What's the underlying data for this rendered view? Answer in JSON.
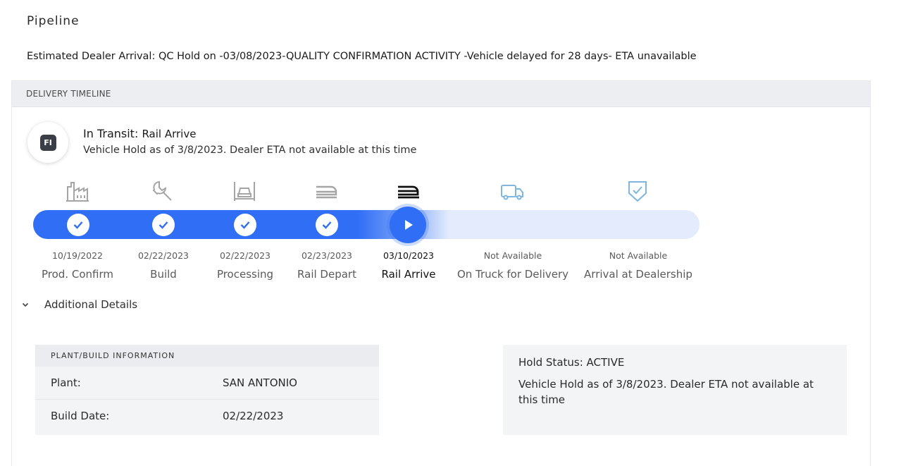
{
  "page": {
    "title": "Pipeline",
    "eta_text": "Estimated Dealer Arrival: QC Hold on -03/08/2023-QUALITY CONFIRMATION ACTIVITY -Vehicle delayed for 28 days- ETA unavailable"
  },
  "timeline": {
    "header": "DELIVERY TIMELINE",
    "avatar_initials": "FI",
    "status_label": "In Transit:",
    "status_stage": "Rail Arrive",
    "status_message": "Vehicle Hold as of 3/8/2023. Dealer ETA not available at this time",
    "progress_completed_stages": 4,
    "current_stage_index": 4,
    "colors": {
      "accent": "#2f6ef5",
      "track": "#e3ebfc",
      "pending_icon": "#7fb6e0",
      "done_icon": "#9a9a9a"
    },
    "stages": [
      {
        "name": "Prod. Confirm",
        "date": "10/19/2022",
        "icon": "factory-icon",
        "state": "done"
      },
      {
        "name": "Build",
        "date": "02/22/2023",
        "icon": "wrench-icon",
        "state": "done"
      },
      {
        "name": "Processing",
        "date": "02/22/2023",
        "icon": "car-lift-icon",
        "state": "done"
      },
      {
        "name": "Rail Depart",
        "date": "02/23/2023",
        "icon": "train-icon",
        "state": "done"
      },
      {
        "name": "Rail Arrive",
        "date": "03/10/2023",
        "icon": "train-icon",
        "state": "current"
      },
      {
        "name": "On Truck for Delivery",
        "date": "Not Available",
        "icon": "truck-icon",
        "state": "pending"
      },
      {
        "name": "Arrival at Dealership",
        "date": "Not Available",
        "icon": "shield-check-icon",
        "state": "pending"
      }
    ]
  },
  "details": {
    "toggle_label": "Additional Details",
    "plant_info": {
      "header": "PLANT/BUILD INFORMATION",
      "rows": [
        {
          "label": "Plant:",
          "value": "SAN ANTONIO"
        },
        {
          "label": "Build Date:",
          "value": "02/22/2023"
        }
      ]
    },
    "hold": {
      "status": "Hold Status: ACTIVE",
      "message": "Vehicle Hold as of 3/8/2023. Dealer ETA not available at this time"
    }
  }
}
